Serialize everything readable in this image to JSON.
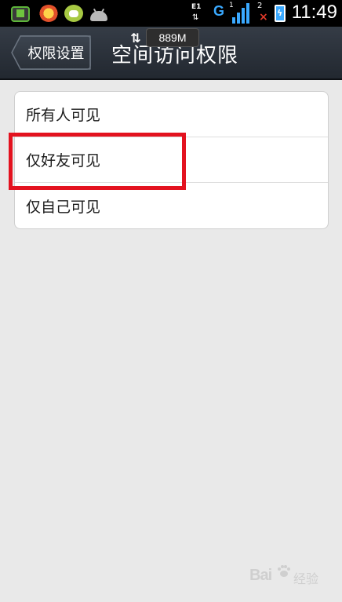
{
  "status_bar": {
    "network_type": "G",
    "data_label": "E1",
    "signal_number": "1",
    "sim2_label": "2",
    "time": "11:49",
    "icons": [
      "app-icon",
      "browser-icon",
      "chat-icon",
      "android-icon",
      "signal-icon",
      "battery-icon"
    ]
  },
  "header": {
    "back_label": "权限设置",
    "title": "空间访问权限",
    "memory": "889M"
  },
  "options": [
    {
      "label": "所有人可见"
    },
    {
      "label": "仅好友可见"
    },
    {
      "label": "仅自己可见"
    }
  ],
  "annotation": {
    "highlighted_option": "仅好友可见",
    "color": "#e3121f"
  },
  "watermark": {
    "brand": "Bai",
    "sub": "经验"
  },
  "colors": {
    "background": "#e9e9e9",
    "title_bar": "#2a3038",
    "network": "#3aa9ff"
  }
}
